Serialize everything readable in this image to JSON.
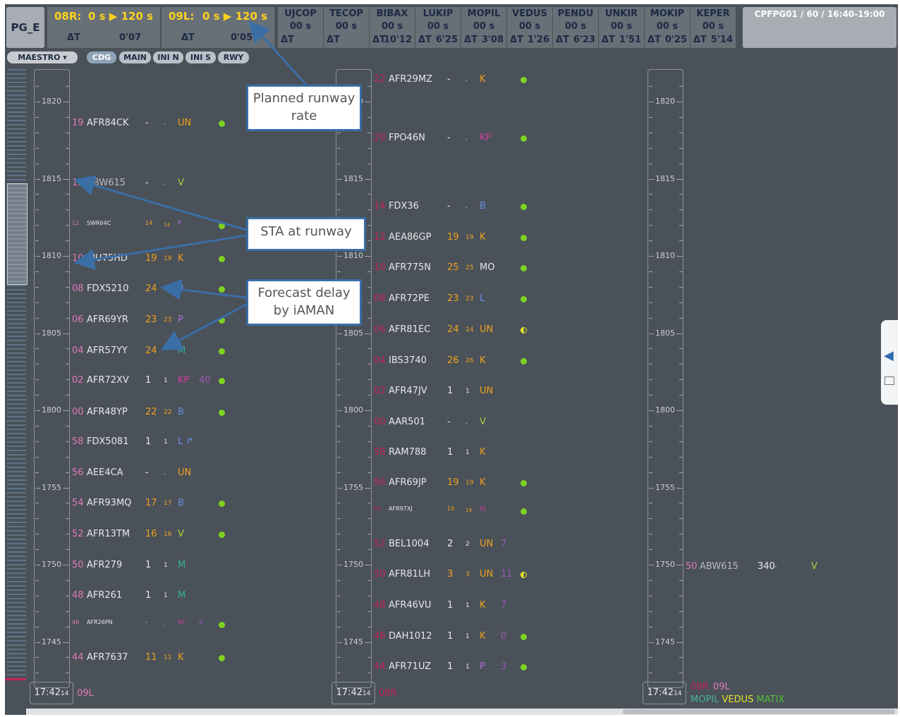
{
  "header": {
    "position": "PG_E",
    "rates": [
      {
        "runway": "08R:",
        "value": "0 s ▶ 120 s",
        "delta_label": "ΔT",
        "delta": "0'07"
      },
      {
        "runway": "09L:",
        "value": "0 s ▶ 120 s",
        "delta_label": "ΔT",
        "delta": "0'05"
      }
    ],
    "fixes": [
      {
        "name": "UJCOP",
        "value": "00 s",
        "delta": ""
      },
      {
        "name": "TECOP",
        "value": "00 s",
        "delta": ""
      },
      {
        "name": "BIBAX",
        "value": "00 s",
        "delta": "10'12"
      },
      {
        "name": "LUKIP",
        "value": "00 s",
        "delta": "6'25"
      },
      {
        "name": "MOPIL",
        "value": "00 s",
        "delta": "3'08"
      },
      {
        "name": "VEDUS",
        "value": "00 s",
        "delta": "1'26"
      },
      {
        "name": "PENDU",
        "value": "00 s",
        "delta": "6'23"
      },
      {
        "name": "UNKIR",
        "value": "00 s",
        "delta": "1'51"
      },
      {
        "name": "MOKIP",
        "value": "00 s",
        "delta": "0'25"
      },
      {
        "name": "KEPER",
        "value": "00 s",
        "delta": "5'14"
      }
    ],
    "session": "CPFPG01 / 60 / 16:40-19:00"
  },
  "toolbar": {
    "maestro": "MAESTRO ▾",
    "tabs": [
      "CDG",
      "MAIN",
      "INI N",
      "INI S",
      "RWY"
    ]
  },
  "timeline_labels": [
    "1820",
    "1815",
    "1810",
    "1805",
    "1800",
    "1755",
    "1750",
    "1745"
  ],
  "columns": [
    {
      "clock": "17:42",
      "clock_sec": "14",
      "footer": "09L",
      "flights": [
        {
          "sta": "19",
          "callsign": "AFR84CK",
          "d1": "-",
          "d2": ".",
          "ac": "UN",
          "extra": "",
          "dot": "green"
        },
        {
          "sta": "15",
          "callsign": "ABW615",
          "d1": "-",
          "d2": ".",
          "ac": "V",
          "extra": "",
          "dot": ""
        },
        {
          "sta": "12",
          "callsign": "SWR64C",
          "d1": "14",
          "d2": "14",
          "ac": "P",
          "extra": "",
          "dot": "green",
          "small": true
        },
        {
          "sta": "10",
          "callsign": "EJU75HD",
          "d1": "19",
          "d2": "19",
          "ac": "K",
          "extra": "",
          "dot": "green"
        },
        {
          "sta": "08",
          "callsign": "FDX5210",
          "d1": "24",
          "d2": "24",
          "ac": "B",
          "extra": "",
          "dot": "green"
        },
        {
          "sta": "06",
          "callsign": "AFR69YR",
          "d1": "23",
          "d2": "23",
          "ac": "P",
          "extra": "",
          "dot": "green"
        },
        {
          "sta": "04",
          "callsign": "AFR57YY",
          "d1": "24",
          "d2": "",
          "ac": "M",
          "extra": "",
          "dot": "green"
        },
        {
          "sta": "02",
          "callsign": "AFR72XV",
          "d1": "1",
          "d2": "1",
          "ac": "KP",
          "extra": "40",
          "dot": "green"
        },
        {
          "sta": "00",
          "callsign": "AFR48YP",
          "d1": "22",
          "d2": "22",
          "ac": "B",
          "extra": "",
          "dot": "green"
        },
        {
          "sta": "58",
          "callsign": "FDX5081",
          "d1": "1",
          "d2": "1",
          "ac": "L ↱",
          "extra": "",
          "dot": ""
        },
        {
          "sta": "56",
          "callsign": "AEE4CA",
          "d1": "-",
          "d2": ".",
          "ac": "UN",
          "extra": "",
          "dot": ""
        },
        {
          "sta": "54",
          "callsign": "AFR93MQ",
          "d1": "17",
          "d2": "17",
          "ac": "B",
          "extra": "",
          "dot": "green"
        },
        {
          "sta": "52",
          "callsign": "AFR13TM",
          "d1": "16",
          "d2": "16",
          "ac": "V",
          "extra": "",
          "dot": "green"
        },
        {
          "sta": "50",
          "callsign": "AFR279",
          "d1": "1",
          "d2": "1",
          "ac": "M",
          "extra": "",
          "dot": ""
        },
        {
          "sta": "48",
          "callsign": "AFR261",
          "d1": "1",
          "d2": "1",
          "ac": "M",
          "extra": "",
          "dot": ""
        },
        {
          "sta": "46",
          "callsign": "AFR26PN",
          "d1": "-",
          "d2": ".",
          "ac": "KP",
          "extra": "0",
          "dot": "green",
          "small": true
        },
        {
          "sta": "44",
          "callsign": "AFR7637",
          "d1": "11",
          "d2": "11",
          "ac": "K",
          "extra": "",
          "dot": "green"
        }
      ]
    },
    {
      "clock": "17:42",
      "clock_sec": "14",
      "footer": "08R",
      "flights": [
        {
          "sta": "22",
          "callsign": "AFR29MZ",
          "d1": "-",
          "d2": ".",
          "ac": "K",
          "extra": "",
          "dot": "green"
        },
        {
          "sta": "20",
          "callsign": "FPO46N",
          "d1": "-",
          "d2": ".",
          "ac": "KP",
          "extra": "",
          "dot": "green"
        },
        {
          "sta": "14",
          "callsign": "FDX36",
          "d1": "-",
          "d2": ".",
          "ac": "B",
          "extra": "",
          "dot": "green"
        },
        {
          "sta": "12",
          "callsign": "AEA86GP",
          "d1": "19",
          "d2": "19",
          "ac": "K",
          "extra": "",
          "dot": "green"
        },
        {
          "sta": "10",
          "callsign": "AFR775N",
          "d1": "25",
          "d2": "25",
          "ac": "MO",
          "extra": "",
          "dot": "green"
        },
        {
          "sta": "08",
          "callsign": "AFR72PE",
          "d1": "23",
          "d2": "23",
          "ac": "L",
          "extra": "",
          "dot": "green"
        },
        {
          "sta": "06",
          "callsign": "AFR81EC",
          "d1": "24",
          "d2": "24",
          "ac": "UN",
          "extra": "",
          "dot": "half"
        },
        {
          "sta": "04",
          "callsign": "IBS3740",
          "d1": "26",
          "d2": "26",
          "ac": "K",
          "extra": "",
          "dot": "green"
        },
        {
          "sta": "02",
          "callsign": "AFR47JV",
          "d1": "1",
          "d2": "1",
          "ac": "UN",
          "extra": "",
          "dot": ""
        },
        {
          "sta": "00",
          "callsign": "AAR501",
          "d1": "-",
          "d2": ".",
          "ac": "V",
          "extra": "",
          "dot": ""
        },
        {
          "sta": "58",
          "callsign": "RAM788",
          "d1": "1",
          "d2": "1",
          "ac": "K",
          "extra": "",
          "dot": ""
        },
        {
          "sta": "56",
          "callsign": "AFR69JP",
          "d1": "19",
          "d2": "19",
          "ac": "K",
          "extra": "",
          "dot": "green"
        },
        {
          "sta": "54",
          "callsign": "AFR97XJ",
          "d1": "19",
          "d2": "19",
          "ac": "DJ",
          "extra": "",
          "dot": "green",
          "small": true
        },
        {
          "sta": "52",
          "callsign": "BEL1004",
          "d1": "2",
          "d2": "2",
          "ac": "UN",
          "extra": "7",
          "dot": ""
        },
        {
          "sta": "50",
          "callsign": "AFR81LH",
          "d1": "3",
          "d2": "3",
          "ac": "UN",
          "extra": "11",
          "dot": "half"
        },
        {
          "sta": "48",
          "callsign": "AFR46VU",
          "d1": "1",
          "d2": "1",
          "ac": "K",
          "extra": "7",
          "dot": ""
        },
        {
          "sta": "46",
          "callsign": "DAH1012",
          "d1": "1",
          "d2": "1",
          "ac": "K",
          "extra": "0",
          "dot": "green"
        },
        {
          "sta": "44",
          "callsign": "AFR71UZ",
          "d1": "1",
          "d2": "1",
          "ac": "P",
          "extra": "3",
          "dot": "green"
        }
      ]
    },
    {
      "clock": "17:42",
      "clock_sec": "14",
      "footer": "08R",
      "footer2": "09L",
      "footer_fixes": [
        "MOPIL",
        "VEDUS",
        "MATIX"
      ],
      "flights": [
        {
          "sta": "50",
          "callsign": "ABW615",
          "d1": "340",
          "d2": "-",
          "ac": "V",
          "extra": "",
          "dot": ""
        }
      ]
    }
  ],
  "callouts": {
    "rate": "Planned runway rate",
    "sta": "STA at runway",
    "delay": "Forecast delay by iAMAN"
  },
  "colors": {
    "background": "#4a5159",
    "sta_pink": "#e07ab8",
    "sta_red": "#c4245a",
    "delay_orange": "#f0a21b",
    "callout_border": "#3a6ea5"
  }
}
